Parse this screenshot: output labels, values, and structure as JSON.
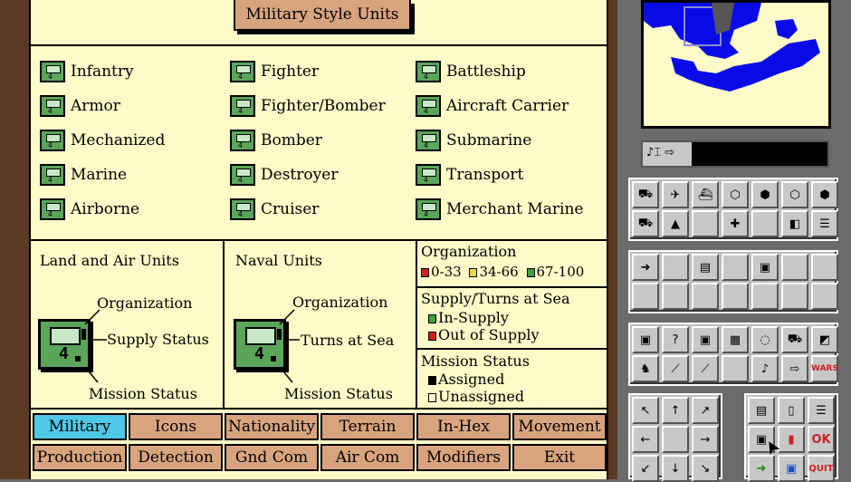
{
  "title": "Military Style Units",
  "units": {
    "col1": [
      {
        "label": "Infantry",
        "icon": "infantry-icon"
      },
      {
        "label": "Armor",
        "icon": "armor-icon"
      },
      {
        "label": "Mechanized",
        "icon": "mechanized-icon"
      },
      {
        "label": "Marine",
        "icon": "marine-icon"
      },
      {
        "label": "Airborne",
        "icon": "airborne-icon"
      }
    ],
    "col2": [
      {
        "label": "Fighter",
        "icon": "fighter-icon"
      },
      {
        "label": "Fighter/Bomber",
        "icon": "fighter-bomber-icon"
      },
      {
        "label": "Bomber",
        "icon": "bomber-icon"
      },
      {
        "label": "Destroyer",
        "icon": "destroyer-icon"
      },
      {
        "label": "Cruiser",
        "icon": "cruiser-icon"
      }
    ],
    "col3": [
      {
        "label": "Battleship",
        "icon": "battleship-icon"
      },
      {
        "label": "Aircraft Carrier",
        "icon": "aircraft-carrier-icon"
      },
      {
        "label": "Submarine",
        "icon": "submarine-icon"
      },
      {
        "label": "Transport",
        "icon": "transport-icon"
      },
      {
        "label": "Merchant Marine",
        "icon": "merchant-marine-icon"
      }
    ],
    "counter_value": "4"
  },
  "land_air": {
    "heading": "Land and Air Units",
    "organization": "Organization",
    "supply": "Supply Status",
    "mission": "Mission Status"
  },
  "naval": {
    "heading": "Naval Units",
    "organization": "Organization",
    "turns": "Turns at Sea",
    "mission": "Mission Status"
  },
  "key": {
    "org_heading": "Organization",
    "org_ranges": [
      "0-33",
      "34-66",
      "67-100"
    ],
    "org_colors": [
      "#d02020",
      "#e8d840",
      "#40a040"
    ],
    "supply_heading": "Supply/Turns at Sea",
    "in_supply": "In-Supply",
    "out_supply": "Out of Supply",
    "mission_heading": "Mission Status",
    "assigned": "Assigned",
    "unassigned": "Unassigned"
  },
  "tabs": {
    "row1": [
      "Military",
      "Icons",
      "Nationality",
      "Terrain",
      "In-Hex",
      "Movement"
    ],
    "row2": [
      "Production",
      "Detection",
      "Gnd Com",
      "Air Com",
      "Modifiers",
      "Exit"
    ],
    "active": "Military"
  },
  "right_panel": {
    "ok_label": "OK",
    "quit_label": "QUIT",
    "wars_label": "WARS",
    "map_colors": {
      "land": "#fffbc8",
      "sea": "#0a0ae8"
    }
  }
}
